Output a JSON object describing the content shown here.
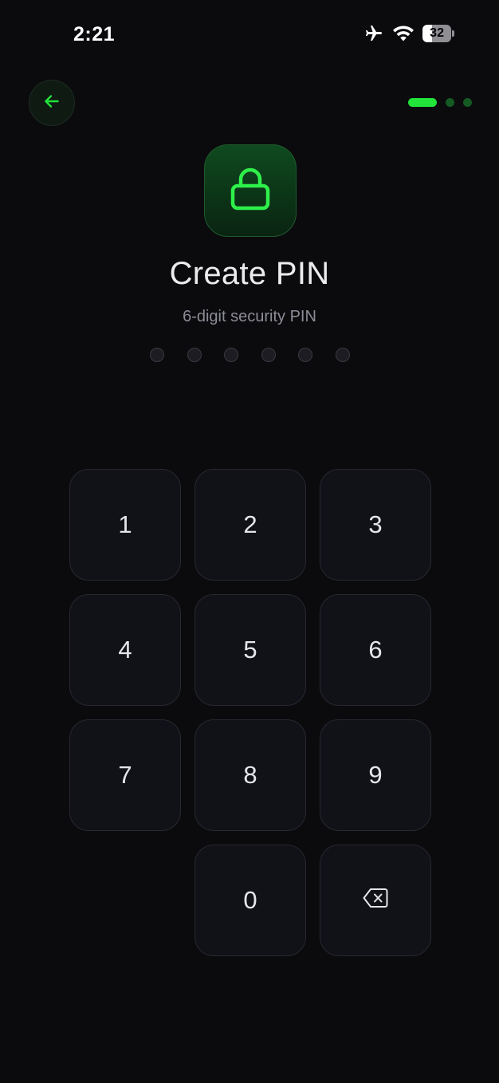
{
  "status_bar": {
    "time": "2:21",
    "battery_level": "32",
    "icons": [
      "airplane-icon",
      "wifi-icon",
      "battery-icon"
    ]
  },
  "header": {
    "back_icon": "arrow-left-icon",
    "steps_total": 3,
    "steps_current": 1
  },
  "hero": {
    "icon": "lock-icon",
    "title": "Create PIN",
    "subtitle": "6-digit security PIN"
  },
  "pin": {
    "length": 6,
    "filled": 0
  },
  "keypad": {
    "keys": [
      "1",
      "2",
      "3",
      "4",
      "5",
      "6",
      "7",
      "8",
      "9",
      "0"
    ],
    "delete_icon": "backspace-icon"
  },
  "colors": {
    "accent": "#22e33a",
    "background": "#0b0b0e",
    "key_background": "#111218"
  }
}
